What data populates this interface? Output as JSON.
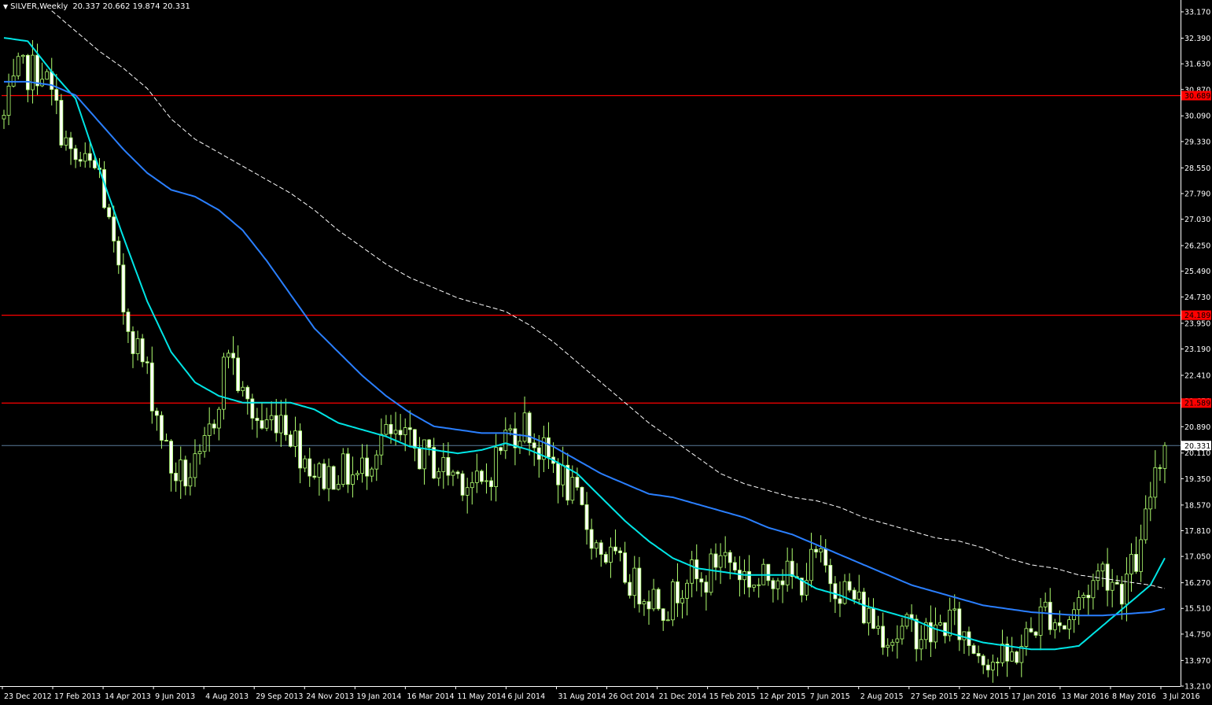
{
  "header": {
    "symbol": "SILVER,Weekly",
    "ohlc": "20.337 20.662 19.874 20.331"
  },
  "colors": {
    "background": "#000000",
    "candle": "#b0ff70",
    "candle_body_up": "#000000",
    "candle_body_down": "#ffffff",
    "ma_fast": "#00e5e5",
    "ma_mid": "#2a7fff",
    "ma_slow": "#ffffff",
    "level": "#ff0000",
    "current_line": "#5b7a99",
    "axis": "#ffffff"
  },
  "chart_data": {
    "type": "candlestick",
    "title": "SILVER,Weekly",
    "ylim": [
      13.21,
      33.17
    ],
    "y_ticks": [
      "33.170",
      "32.390",
      "31.630",
      "30.870",
      "30.090",
      "29.330",
      "28.550",
      "27.790",
      "27.030",
      "26.250",
      "25.490",
      "24.730",
      "23.950",
      "23.190",
      "22.410",
      "21.650",
      "20.890",
      "20.110",
      "19.350",
      "18.570",
      "17.810",
      "17.050",
      "16.270",
      "15.510",
      "14.750",
      "13.970",
      "13.210"
    ],
    "x_labels": [
      "23 Dec 2012",
      "17 Feb 2013",
      "14 Apr 2013",
      "9 Jun 2013",
      "4 Aug 2013",
      "29 Sep 2013",
      "24 Nov 2013",
      "19 Jan 2014",
      "16 Mar 2014",
      "11 May 2014",
      "6 Jul 2014",
      "31 Aug 2014",
      "26 Oct 2014",
      "21 Dec 2014",
      "15 Feb 2015",
      "12 Apr 2015",
      "7 Jun 2015",
      "2 Aug 2015",
      "27 Sep 2015",
      "22 Nov 2015",
      "17 Jan 2016",
      "13 Mar 2016",
      "8 May 2016",
      "3 Jul 2016"
    ],
    "horizontal_levels": [
      {
        "value": 30.689,
        "label": "30.689"
      },
      {
        "value": 24.189,
        "label": "24.189"
      },
      {
        "value": 21.589,
        "label": "21.589"
      }
    ],
    "current_price": {
      "value": 20.331,
      "label": "20.331"
    },
    "candle_anchors": [
      [
        0,
        30.0
      ],
      [
        3,
        31.3
      ],
      [
        8,
        31.5
      ],
      [
        11,
        30.2
      ],
      [
        14,
        28.8
      ],
      [
        20,
        28.4
      ],
      [
        25,
        24.4
      ],
      [
        30,
        22.4
      ],
      [
        35,
        19.6
      ],
      [
        38,
        19.4
      ],
      [
        41,
        19.7
      ],
      [
        44,
        21.2
      ],
      [
        47,
        23.3
      ],
      [
        50,
        21.7
      ],
      [
        54,
        20.9
      ],
      [
        58,
        21.3
      ],
      [
        62,
        20.2
      ],
      [
        66,
        19.4
      ],
      [
        70,
        19.6
      ],
      [
        74,
        19.4
      ],
      [
        79,
        20.6
      ],
      [
        84,
        20.4
      ],
      [
        90,
        19.8
      ],
      [
        96,
        19.4
      ],
      [
        100,
        19.0
      ],
      [
        105,
        20.6
      ],
      [
        109,
        21.0
      ],
      [
        112,
        20.2
      ],
      [
        116,
        19.6
      ],
      [
        120,
        18.6
      ],
      [
        124,
        17.4
      ],
      [
        128,
        16.8
      ],
      [
        132,
        16.2
      ],
      [
        136,
        15.9
      ],
      [
        139,
        15.6
      ],
      [
        143,
        16.6
      ],
      [
        146,
        16.1
      ],
      [
        150,
        17.2
      ],
      [
        154,
        16.6
      ],
      [
        158,
        16.2
      ],
      [
        162,
        16.7
      ],
      [
        166,
        16.2
      ],
      [
        170,
        17.0
      ],
      [
        174,
        16.3
      ],
      [
        178,
        15.8
      ],
      [
        182,
        15.1
      ],
      [
        186,
        14.7
      ],
      [
        190,
        14.9
      ],
      [
        194,
        14.7
      ],
      [
        198,
        15.2
      ],
      [
        202,
        14.5
      ],
      [
        206,
        14.1
      ],
      [
        210,
        13.9
      ],
      [
        214,
        14.6
      ],
      [
        218,
        15.5
      ],
      [
        222,
        15.0
      ],
      [
        226,
        15.9
      ],
      [
        230,
        16.7
      ],
      [
        234,
        16.1
      ],
      [
        238,
        17.2
      ],
      [
        241,
        19.8
      ],
      [
        243,
        20.3
      ]
    ],
    "series": [
      {
        "name": "MA fast",
        "color": "#00e5e5",
        "points": [
          [
            0,
            32.4
          ],
          [
            5,
            32.3
          ],
          [
            10,
            31.4
          ],
          [
            15,
            30.6
          ],
          [
            20,
            28.5
          ],
          [
            25,
            26.5
          ],
          [
            30,
            24.6
          ],
          [
            35,
            23.1
          ],
          [
            40,
            22.2
          ],
          [
            45,
            21.8
          ],
          [
            50,
            21.6
          ],
          [
            55,
            21.6
          ],
          [
            60,
            21.6
          ],
          [
            65,
            21.4
          ],
          [
            70,
            21.0
          ],
          [
            75,
            20.8
          ],
          [
            80,
            20.6
          ],
          [
            85,
            20.3
          ],
          [
            90,
            20.2
          ],
          [
            95,
            20.1
          ],
          [
            100,
            20.2
          ],
          [
            105,
            20.4
          ],
          [
            110,
            20.2
          ],
          [
            115,
            19.9
          ],
          [
            120,
            19.5
          ],
          [
            125,
            18.8
          ],
          [
            130,
            18.1
          ],
          [
            135,
            17.5
          ],
          [
            140,
            17.0
          ],
          [
            145,
            16.7
          ],
          [
            150,
            16.6
          ],
          [
            155,
            16.5
          ],
          [
            160,
            16.5
          ],
          [
            165,
            16.5
          ],
          [
            170,
            16.1
          ],
          [
            175,
            15.9
          ],
          [
            180,
            15.6
          ],
          [
            185,
            15.4
          ],
          [
            190,
            15.2
          ],
          [
            195,
            14.9
          ],
          [
            200,
            14.7
          ],
          [
            205,
            14.5
          ],
          [
            210,
            14.4
          ],
          [
            215,
            14.3
          ],
          [
            220,
            14.3
          ],
          [
            225,
            14.4
          ],
          [
            230,
            15.0
          ],
          [
            235,
            15.6
          ],
          [
            240,
            16.2
          ],
          [
            243,
            17.0
          ]
        ]
      },
      {
        "name": "MA mid",
        "color": "#2a7fff",
        "points": [
          [
            0,
            31.1
          ],
          [
            5,
            31.1
          ],
          [
            10,
            31.0
          ],
          [
            15,
            30.7
          ],
          [
            20,
            29.9
          ],
          [
            25,
            29.1
          ],
          [
            30,
            28.4
          ],
          [
            35,
            27.9
          ],
          [
            40,
            27.7
          ],
          [
            45,
            27.3
          ],
          [
            50,
            26.7
          ],
          [
            55,
            25.8
          ],
          [
            60,
            24.8
          ],
          [
            65,
            23.8
          ],
          [
            70,
            23.1
          ],
          [
            75,
            22.4
          ],
          [
            80,
            21.8
          ],
          [
            85,
            21.3
          ],
          [
            90,
            20.9
          ],
          [
            95,
            20.8
          ],
          [
            100,
            20.7
          ],
          [
            105,
            20.7
          ],
          [
            110,
            20.6
          ],
          [
            115,
            20.3
          ],
          [
            120,
            19.9
          ],
          [
            125,
            19.5
          ],
          [
            130,
            19.2
          ],
          [
            135,
            18.9
          ],
          [
            140,
            18.8
          ],
          [
            145,
            18.6
          ],
          [
            150,
            18.4
          ],
          [
            155,
            18.2
          ],
          [
            160,
            17.9
          ],
          [
            165,
            17.7
          ],
          [
            170,
            17.4
          ],
          [
            175,
            17.1
          ],
          [
            180,
            16.8
          ],
          [
            185,
            16.5
          ],
          [
            190,
            16.2
          ],
          [
            195,
            16.0
          ],
          [
            200,
            15.8
          ],
          [
            205,
            15.6
          ],
          [
            210,
            15.5
          ],
          [
            215,
            15.4
          ],
          [
            220,
            15.35
          ],
          [
            225,
            15.3
          ],
          [
            230,
            15.3
          ],
          [
            235,
            15.35
          ],
          [
            240,
            15.4
          ],
          [
            243,
            15.5
          ]
        ]
      },
      {
        "name": "MA slow",
        "color": "#ffffff",
        "points": [
          [
            10,
            33.2
          ],
          [
            15,
            32.6
          ],
          [
            20,
            32.0
          ],
          [
            25,
            31.5
          ],
          [
            30,
            30.9
          ],
          [
            35,
            30.0
          ],
          [
            40,
            29.4
          ],
          [
            45,
            29.0
          ],
          [
            50,
            28.6
          ],
          [
            55,
            28.2
          ],
          [
            60,
            27.8
          ],
          [
            65,
            27.3
          ],
          [
            70,
            26.7
          ],
          [
            75,
            26.2
          ],
          [
            80,
            25.7
          ],
          [
            85,
            25.3
          ],
          [
            90,
            25.0
          ],
          [
            95,
            24.7
          ],
          [
            100,
            24.5
          ],
          [
            105,
            24.3
          ],
          [
            110,
            23.9
          ],
          [
            115,
            23.4
          ],
          [
            120,
            22.8
          ],
          [
            125,
            22.2
          ],
          [
            130,
            21.6
          ],
          [
            135,
            21.0
          ],
          [
            140,
            20.5
          ],
          [
            145,
            20.0
          ],
          [
            150,
            19.5
          ],
          [
            155,
            19.2
          ],
          [
            160,
            19.0
          ],
          [
            165,
            18.8
          ],
          [
            170,
            18.7
          ],
          [
            175,
            18.5
          ],
          [
            180,
            18.2
          ],
          [
            185,
            18.0
          ],
          [
            190,
            17.8
          ],
          [
            195,
            17.6
          ],
          [
            200,
            17.5
          ],
          [
            205,
            17.3
          ],
          [
            210,
            17.0
          ],
          [
            215,
            16.8
          ],
          [
            220,
            16.7
          ],
          [
            225,
            16.5
          ],
          [
            230,
            16.4
          ],
          [
            235,
            16.3
          ],
          [
            240,
            16.2
          ],
          [
            243,
            16.1
          ]
        ]
      }
    ],
    "grid": false,
    "legend": "none"
  }
}
